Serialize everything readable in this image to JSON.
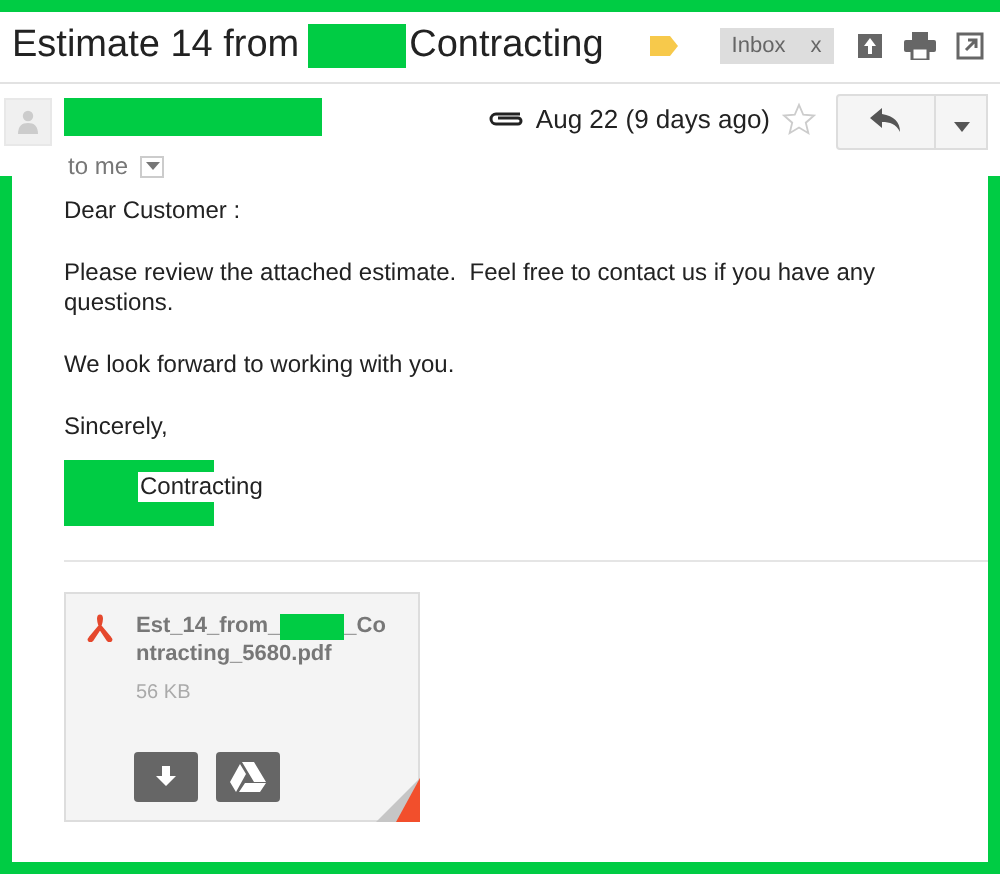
{
  "subject": {
    "before": "Estimate 14 from",
    "after": "Contracting"
  },
  "label": {
    "name": "Inbox",
    "close": "x"
  },
  "message": {
    "date": "Aug 22 (9 days ago)",
    "starred": false,
    "recipient": "to me",
    "body": [
      "Dear Customer :",
      "Please review the attached estimate.  Feel free to contact us if you have any questions.",
      "We look forward to working with you.",
      "Sincerely,"
    ],
    "signature": "Contracting"
  },
  "attachment": {
    "name_start": "Est_14_from_",
    "name_end": "_Co",
    "name_line2": "ntracting_5680.pdf",
    "size": "56 KB"
  }
}
